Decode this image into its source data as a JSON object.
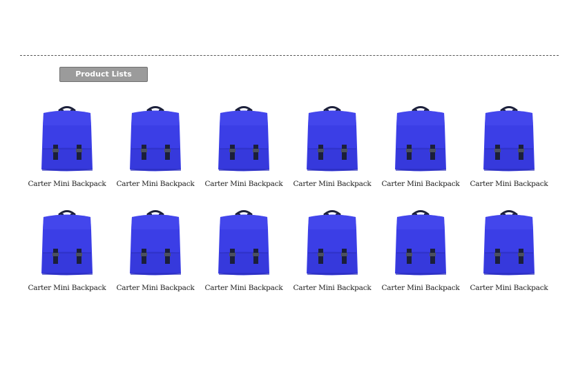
{
  "header": {
    "tab_label": "Product Lists"
  },
  "products": [
    {
      "name": "Carter Mini Backpack",
      "image": "blue-backpack",
      "color": "#3b3ee6"
    },
    {
      "name": "Carter Mini Backpack",
      "image": "blue-backpack",
      "color": "#3b3ee6"
    },
    {
      "name": "Carter Mini Backpack",
      "image": "blue-backpack",
      "color": "#3b3ee6"
    },
    {
      "name": "Carter Mini Backpack",
      "image": "blue-backpack",
      "color": "#3b3ee6"
    },
    {
      "name": "Carter Mini Backpack",
      "image": "blue-backpack",
      "color": "#3b3ee6"
    },
    {
      "name": "Carter Mini Backpack",
      "image": "blue-backpack",
      "color": "#3b3ee6"
    },
    {
      "name": "Carter Mini Backpack",
      "image": "blue-backpack",
      "color": "#3b3ee6"
    },
    {
      "name": "Carter Mini Backpack",
      "image": "blue-backpack",
      "color": "#3b3ee6"
    },
    {
      "name": "Carter Mini Backpack",
      "image": "blue-backpack",
      "color": "#3b3ee6"
    },
    {
      "name": "Carter Mini Backpack",
      "image": "blue-backpack",
      "color": "#3b3ee6"
    },
    {
      "name": "Carter Mini Backpack",
      "image": "blue-backpack",
      "color": "#3b3ee6"
    },
    {
      "name": "Carter Mini Backpack",
      "image": "blue-backpack",
      "color": "#3b3ee6"
    }
  ]
}
